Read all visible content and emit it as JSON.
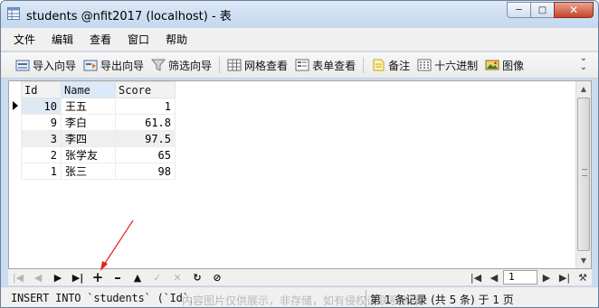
{
  "window": {
    "title": "students @nfit2017 (localhost) - 表"
  },
  "menu": {
    "items": [
      "文件",
      "编辑",
      "查看",
      "窗口",
      "帮助"
    ]
  },
  "toolbar": {
    "import": "导入向导",
    "export": "导出向导",
    "filter": "筛选向导",
    "grid_view": "网格查看",
    "form_view": "表单查看",
    "memo": "备注",
    "hex": "十六进制",
    "image": "图像"
  },
  "grid": {
    "columns": [
      "Id",
      "Name",
      "Score"
    ],
    "rows": [
      {
        "id": "10",
        "name": "王五",
        "score": "1"
      },
      {
        "id": "9",
        "name": "李白",
        "score": "61.8"
      },
      {
        "id": "3",
        "name": "李四",
        "score": "97.5"
      },
      {
        "id": "2",
        "name": "张学友",
        "score": "65"
      },
      {
        "id": "1",
        "name": "张三",
        "score": "98"
      }
    ]
  },
  "navigation": {
    "page": "1"
  },
  "status": {
    "sql": "INSERT INTO `students` (`Id`, `Na",
    "record": "第 1 条记录 (共 5 条) 于 1 页",
    "watermark": "内容图片仅供展示，非存储，如有侵权请联系删除。"
  },
  "colors": {
    "accent": "#c7442a",
    "selection": "#dbe9f8",
    "annotation": "#e8201a"
  }
}
